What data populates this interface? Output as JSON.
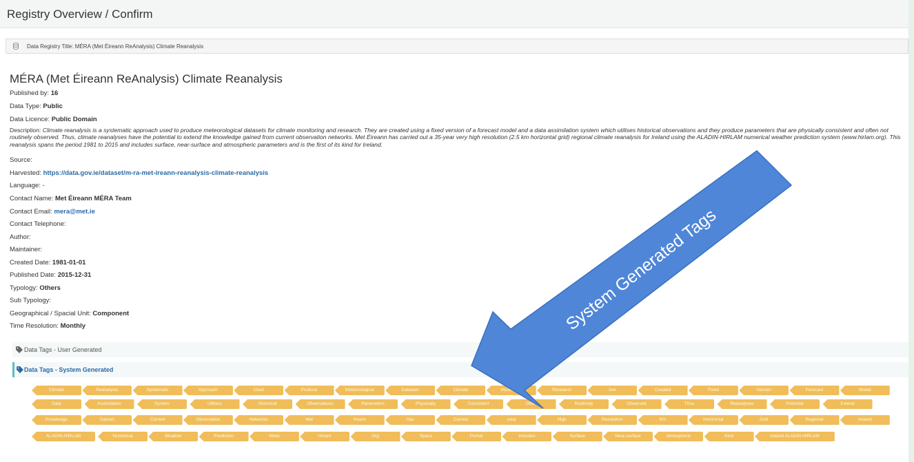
{
  "header": {
    "title": "Registry Overview / Confirm"
  },
  "panel": {
    "heading": "Data Registry Title: MÉRA (Met Éireann ReAnalysis) Climate Reanalysis"
  },
  "dataset": {
    "title": "MÉRA (Met Éireann ReAnalysis) Climate Reanalysis",
    "published_by_label": "Published by: ",
    "published_by": "16",
    "data_type_label": "Data Type: ",
    "data_type": "Public",
    "data_licence_label": "Data Licence: ",
    "data_licence": "Public Domain",
    "description_label": "Description: ",
    "description": "Climate reanalysis is a systematic approach used to produce meteorological datasets for climate monitoring and research. They are created using a fixed version of a forecast model and a data assimilation system which utilises historical observations and they produce parameters that are physically consistent and often not routinely observed. Thus, climate reanalyses have the potential to extend the knowledge gained from current observation networks. Met Éireann has carried out a 35-year very high resolution (2.5 km horizontal grid) regional climate reanalysis for Ireland using the ALADIN-HIRLAM numerical weather prediction system (www.hirlam.org). This reanalysis spans the period 1981 to 2015 and includes surface, near-surface and atmospheric parameters and is the first of its kind for Ireland.",
    "source_label": "Source:",
    "harvested_label": "Harvested: ",
    "harvested": "https://data.gov.ie/dataset/m-ra-met-ireann-reanalysis-climate-reanalysis",
    "language_label": "Language: ",
    "language": "-",
    "contact_name_label": "Contact Name: ",
    "contact_name": "Met Éireann MÉRA Team",
    "contact_email_label": "Contact Email: ",
    "contact_email": "mera@met.ie",
    "contact_telephone_label": "Contact Telephone:",
    "author_label": "Author:",
    "maintainer_label": "Maintainer:",
    "created_date_label": "Created Date: ",
    "created_date": "1981-01-01",
    "published_date_label": "Published Date: ",
    "published_date": "2015-12-31",
    "typology_label": "Typology: ",
    "typology": "Others",
    "sub_typology_label": "Sub Typology:",
    "geo_unit_label": "Geographical / Spacial Unit: ",
    "geo_unit": "Component",
    "time_resolution_label": "Time Resolution: ",
    "time_resolution": "Monthly"
  },
  "sections": {
    "user_tags": "Data Tags - User Generated",
    "system_tags": "Data Tags - System Generated"
  },
  "system_tags": [
    [
      "Climate",
      "Reanalysis",
      "Systematic",
      "Approach",
      "Used",
      "Produce",
      "Meteorological",
      "Datasets",
      "Climate",
      "Monitoring",
      "Research",
      "Are",
      "Created",
      "Fixed",
      "Version",
      "Forecast",
      "Model"
    ],
    [
      "Data",
      "Assimilation",
      "System",
      "Utilises",
      "Historical",
      "Observations",
      "Parameters",
      "Physically",
      "Consistent",
      "Often",
      "Routinely",
      "Observed",
      "Thus",
      "Reanalyses",
      "Potential",
      "Extend"
    ],
    [
      "Knowledge",
      "Gained",
      "Current",
      "Observation",
      "Networks",
      "Met",
      "Ireann",
      "Has",
      "Carried",
      "-year",
      "High",
      "Resolution",
      "Km",
      "Horizontal",
      "Grid",
      "Regional",
      "Ireland"
    ],
    [
      "ALADIN-HIRLAM",
      "Numerical",
      "Weather",
      "Prediction",
      "Www",
      "Hirlam",
      "Org",
      "Spans",
      "Period",
      "Includes",
      "Surface",
      "Near-surface",
      "Atmospheric",
      "Kind",
      "Ireland ALADIN-HIRLAM"
    ]
  ],
  "annotation": {
    "text": "System Generated Tags",
    "color": "#4f86d8"
  },
  "colors": {
    "tag": "#f0bd5a",
    "link": "#2a6aa8",
    "accent_border": "#5cbcc8"
  }
}
